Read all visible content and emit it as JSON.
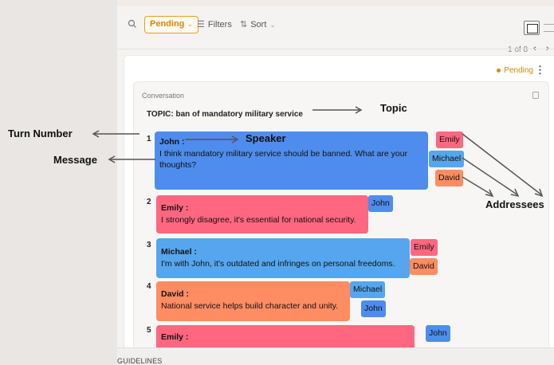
{
  "toolbar": {
    "pending_label": "Pending",
    "filters_label": "Filters",
    "sort_label": "Sort"
  },
  "pager": {
    "text": "1 of 8",
    "prev": "‹",
    "next": "›"
  },
  "card": {
    "status": "Pending"
  },
  "conversation": {
    "label": "Conversation",
    "topic": "TOPIC: ban of mandatory military service",
    "turns": [
      {
        "num": "1",
        "speaker": "John :",
        "message": "I think mandatory military service should be banned. What are your thoughts?",
        "addressees": [
          "Emily",
          "Michael",
          "David"
        ]
      },
      {
        "num": "2",
        "speaker": "Emily :",
        "message": "I strongly disagree, it's essential for national security.",
        "addressees": [
          "John"
        ]
      },
      {
        "num": "3",
        "speaker": "Michael :",
        "message": "I'm with John, it's outdated and infringes on personal freedoms.",
        "addressees": [
          "Emily",
          "David"
        ]
      },
      {
        "num": "4",
        "speaker": "David :",
        "message": "National service helps build character and unity.",
        "addressees": [
          "Michael",
          "John"
        ]
      },
      {
        "num": "5",
        "speaker": "Emily :",
        "message": "",
        "addressees": [
          "John"
        ]
      }
    ]
  },
  "guidelines": "GUIDELINES",
  "annotations": {
    "turn_number": "Turn Number",
    "message": "Message",
    "speaker": "Speaker",
    "topic": "Topic",
    "addressees": "Addressees"
  },
  "colors": {
    "john": "#4e8ded",
    "emily": "#ff6680",
    "michael": "#55a6ee",
    "david": "#ff8c63",
    "pending": "#e8a020"
  }
}
